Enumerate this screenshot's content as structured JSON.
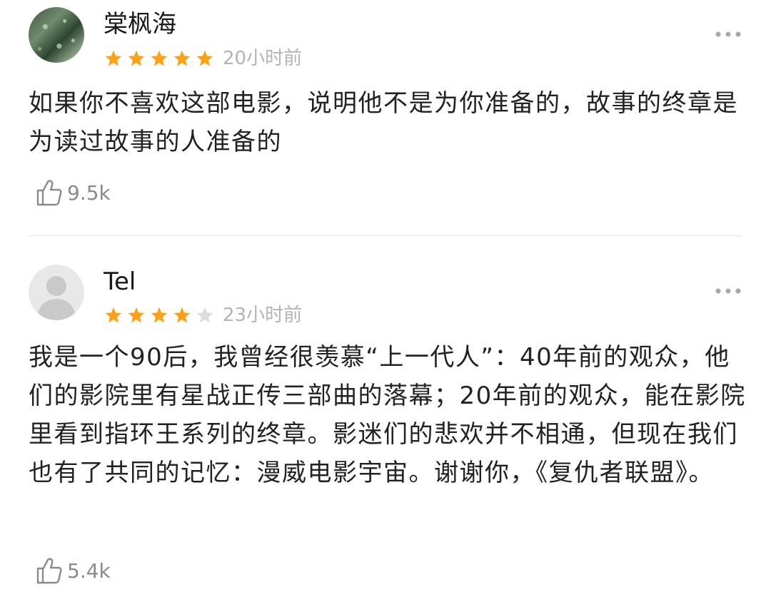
{
  "colors": {
    "star_filled": "#f7a21b",
    "star_empty": "#dcdcdc",
    "time_text": "#b3b3b3",
    "like_text": "#8a8a8a",
    "divider": "#e6e6e6"
  },
  "reviews": [
    {
      "username": "棠枫海",
      "rating": 5,
      "max_rating": 5,
      "time": "20小时前",
      "content": "如果你不喜欢这部电影，说明他不是为你准备的，故事的终章是为读过故事的人准备的",
      "likes": "9.5k",
      "avatar_icon": "landscape-photo-avatar",
      "more_icon": "more-dots-icon",
      "like_icon": "thumbs-up-icon"
    },
    {
      "username": "Tel",
      "rating": 4,
      "max_rating": 5,
      "time": "23小时前",
      "content": "我是一个90后，我曾经很羡慕“上一代人”：40年前的观众，他们的影院里有星战正传三部曲的落幕；20年前的观众，能在影院里看到指环王系列的终章。影迷们的悲欢并不相通，但现在我们也有了共同的记忆：漫威电影宇宙。谢谢你，《复仇者联盟》。",
      "likes": "5.4k",
      "avatar_icon": "default-user-avatar",
      "more_icon": "more-dots-icon",
      "like_icon": "thumbs-up-icon"
    }
  ]
}
